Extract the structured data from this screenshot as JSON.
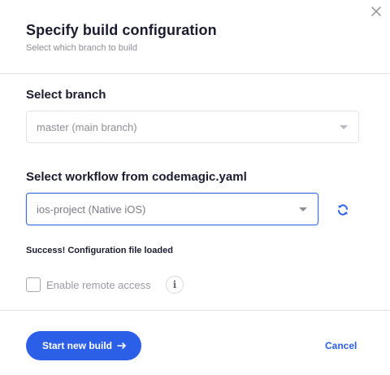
{
  "dialog": {
    "title": "Specify build configuration",
    "subtitle": "Select which branch to build",
    "close_icon": "close-icon"
  },
  "branch": {
    "label": "Select branch",
    "value": "master (main branch)"
  },
  "workflow": {
    "label": "Select workflow from codemagic.yaml",
    "value": "ios-project (Native iOS)",
    "refresh_icon": "refresh-icon"
  },
  "status": {
    "message": "Success! Configuration file loaded"
  },
  "remote_access": {
    "label": "Enable remote access",
    "checked": false,
    "info_icon": "info-icon",
    "info_glyph": "i"
  },
  "footer": {
    "primary_label": "Start new build",
    "arrow_icon": "arrow-right-icon",
    "cancel_label": "Cancel"
  },
  "colors": {
    "accent": "#2c5fe8",
    "text": "#1b1b2f",
    "muted": "#8e8e98",
    "border": "#e2e2e6"
  }
}
